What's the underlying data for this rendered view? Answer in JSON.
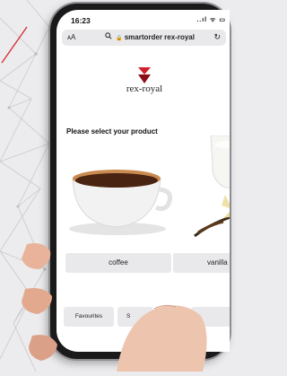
{
  "status_bar": {
    "time": "16:23",
    "icons": "..ıl ᯤ ▭"
  },
  "browser": {
    "aa": "ᴀA",
    "lock": "🔒",
    "url": "smartorder rex-royal",
    "reload": "↻"
  },
  "brand": {
    "name": "rex-royal",
    "color": "#d21f28"
  },
  "page": {
    "prompt": "Please select your product",
    "products": [
      {
        "label": "coffee",
        "icon": "coffee-cup"
      },
      {
        "label": "vanilla",
        "icon": "milk-vanilla"
      }
    ],
    "tabs": [
      {
        "label": "Favourites"
      },
      {
        "label": "S"
      }
    ]
  }
}
